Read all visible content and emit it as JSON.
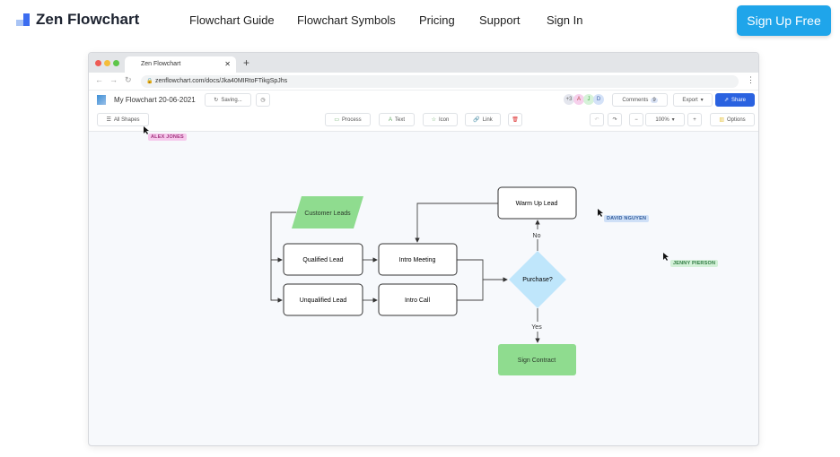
{
  "site": {
    "brand": "Zen Flowchart",
    "nav": [
      "Flowchart Guide",
      "Flowchart Symbols",
      "Pricing",
      "Support",
      "Sign In"
    ],
    "signup": "Sign Up Free",
    "accent": "#1fa5ea"
  },
  "browser": {
    "tab_title": "Zen Flowchart",
    "url": "zenflowchart.com/docs/Jka40MIRtoFTikgSpJhs"
  },
  "app": {
    "doc_title": "My Flowchart 20-06-2021",
    "saving": "Saving...",
    "collaborators": {
      "extra": "+3",
      "avatars": [
        "A",
        "J",
        "D"
      ]
    },
    "comments_label": "Comments",
    "comments_count": "9",
    "export": "Export",
    "share": "Share"
  },
  "toolbar": {
    "all_shapes": "All Shapes",
    "process": "Process",
    "text": "Text",
    "icon": "Icon",
    "link": "Link",
    "zoom": "100%",
    "options": "Options"
  },
  "cursors": [
    {
      "name": "ALEX JONES",
      "color": "#f6c9ec"
    },
    {
      "name": "DAVID NGUYEN",
      "color": "#cfe0f7"
    },
    {
      "name": "JENNY PIERSON",
      "color": "#d3f1d8"
    }
  ],
  "flowchart": {
    "nodes": {
      "customer_leads": "Customer Leads",
      "qualified": "Qualified Lead",
      "unqualified": "Unqualified Lead",
      "intro_meeting": "Intro Meeting",
      "intro_call": "Intro Call",
      "warm_up": "Warm Up Lead",
      "purchase": "Purchase?",
      "sign_contract": "Sign Contract"
    },
    "edge_labels": {
      "no": "No",
      "yes": "Yes"
    }
  }
}
